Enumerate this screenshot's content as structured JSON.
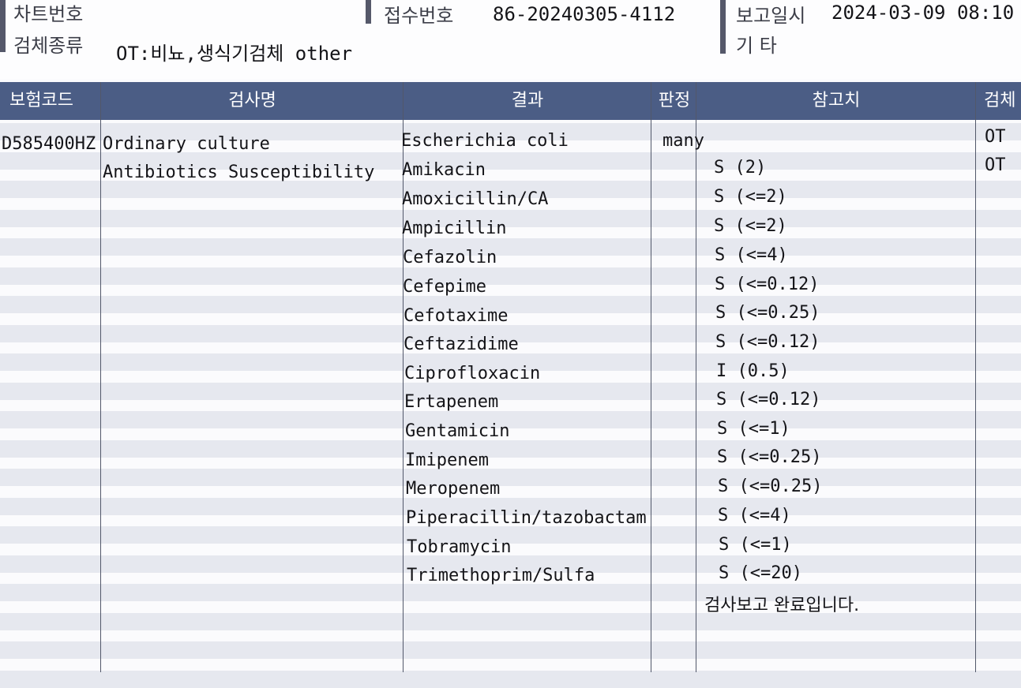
{
  "header": {
    "chart_no_label": "차트번호",
    "specimen_type_label": "검체종류",
    "specimen_type_value": "OT:비뇨,생식기검체 other",
    "receipt_no_label": "접수번호",
    "receipt_no_value": "86-20240305-4112",
    "report_datetime_label": "보고일시",
    "report_datetime_value": "2024-03-09 08:10",
    "misc_label": "기 타"
  },
  "table": {
    "columns": [
      "보험코드",
      "검사명",
      "결과",
      "판정",
      "참고치",
      "검체"
    ],
    "insurance_code": "D585400HZ",
    "test_names": [
      "Ordinary culture",
      "Antibiotics Susceptibility"
    ],
    "specimens": [
      "OT",
      "OT"
    ],
    "organism": "Escherichia coli",
    "organism_judgement": "many",
    "results": [
      {
        "name": "Amikacin",
        "value": "S (2)"
      },
      {
        "name": "Amoxicillin/CA",
        "value": "S (<=2)"
      },
      {
        "name": "Ampicillin",
        "value": "S (<=2)"
      },
      {
        "name": "Cefazolin",
        "value": "S (<=4)"
      },
      {
        "name": "Cefepime",
        "value": "S (<=0.12)"
      },
      {
        "name": "Cefotaxime",
        "value": "S (<=0.25)"
      },
      {
        "name": "Ceftazidime",
        "value": "S (<=0.12)"
      },
      {
        "name": "Ciprofloxacin",
        "value": "I (0.5)"
      },
      {
        "name": "Ertapenem",
        "value": "S (<=0.12)"
      },
      {
        "name": "Gentamicin",
        "value": "S (<=1)"
      },
      {
        "name": "Imipenem",
        "value": "S (<=0.25)"
      },
      {
        "name": "Meropenem",
        "value": "S (<=0.25)"
      },
      {
        "name": "Piperacillin/tazobactam",
        "value": "S (<=4)"
      },
      {
        "name": "Tobramycin",
        "value": "S (<=1)"
      },
      {
        "name": "Trimethoprim/Sulfa",
        "value": "S (<=20)"
      }
    ],
    "completion_note": "검사보고 완료입니다."
  }
}
